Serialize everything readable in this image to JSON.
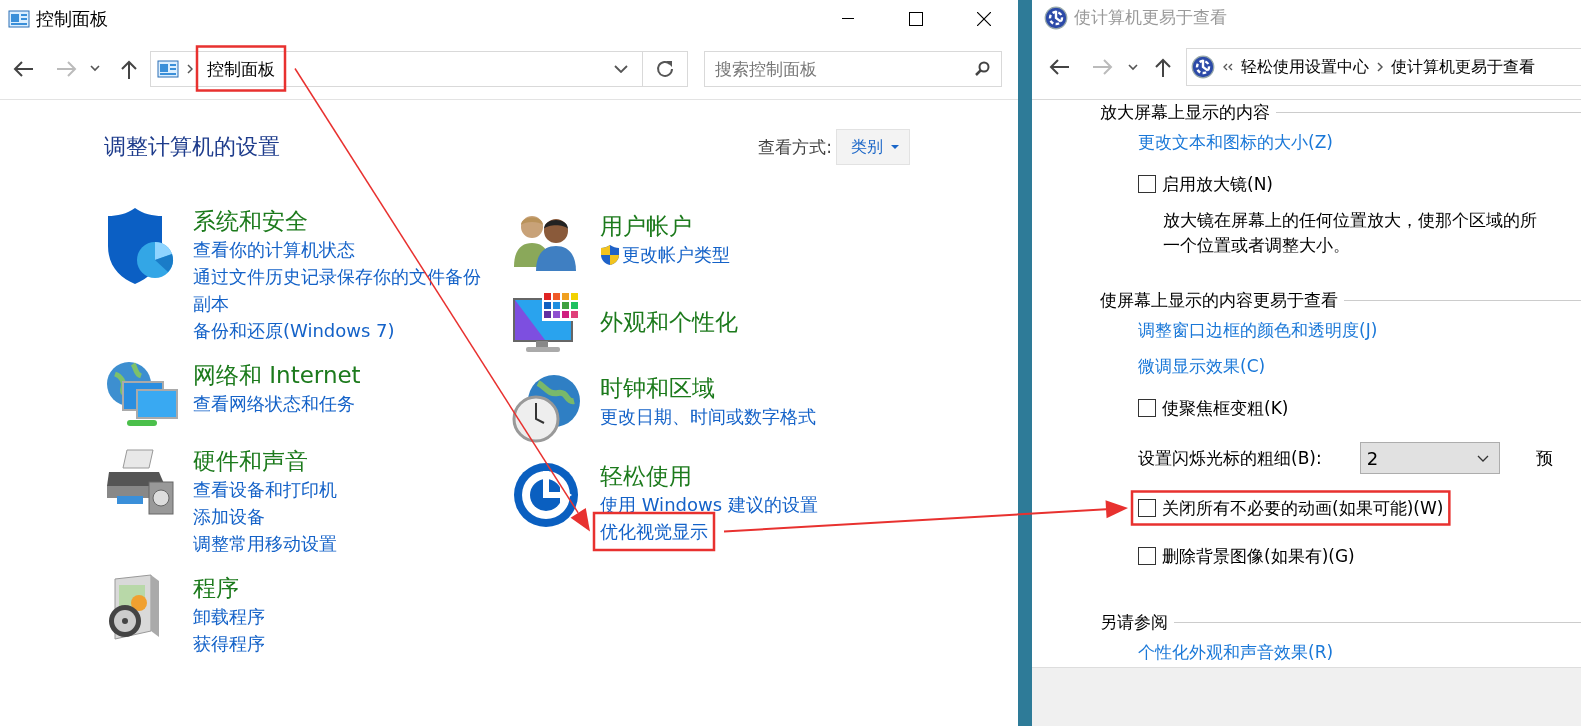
{
  "control_panel": {
    "title": "控制面板",
    "address": {
      "text": "控制面板",
      "highlighted": true
    },
    "search": {
      "placeholder": "搜索控制面板"
    },
    "heading": "调整计算机的设置",
    "view_by": {
      "label": "查看方式:",
      "value": "类别"
    },
    "columns": [
      [
        {
          "kind": "security",
          "title": "系统和安全",
          "links": [
            {
              "kind": "link",
              "text": "查看你的计算机状态",
              "highlighted": false
            },
            {
              "kind": "link",
              "text": "通过文件历史记录保存你的文件备份副本",
              "highlighted": false
            },
            {
              "kind": "link",
              "text": "备份和还原(Windows 7)",
              "highlighted": false
            }
          ]
        },
        {
          "kind": "network",
          "title": "网络和 Internet",
          "links": [
            {
              "kind": "link",
              "text": "查看网络状态和任务",
              "highlighted": false
            }
          ]
        },
        {
          "kind": "hardware",
          "title": "硬件和声音",
          "links": [
            {
              "kind": "link",
              "text": "查看设备和打印机",
              "highlighted": false
            },
            {
              "kind": "link",
              "text": "添加设备",
              "highlighted": false
            },
            {
              "kind": "link",
              "text": "调整常用移动设置",
              "highlighted": false
            }
          ]
        },
        {
          "kind": "programs",
          "title": "程序",
          "links": [
            {
              "kind": "link",
              "text": "卸载程序",
              "highlighted": false
            },
            {
              "kind": "link",
              "text": "获得程序",
              "highlighted": false
            }
          ]
        }
      ],
      [
        {
          "kind": "users",
          "title": "用户帐户",
          "links": [
            {
              "kind": "shield-link",
              "text": "更改帐户类型"
            }
          ]
        },
        {
          "kind": "appearance",
          "title": "外观和个性化"
        },
        {
          "kind": "clock",
          "title": "时钟和区域",
          "links": [
            {
              "kind": "link",
              "text": "更改日期、时间或数字格式",
              "highlighted": false
            }
          ]
        },
        {
          "kind": "ease",
          "title": "轻松使用",
          "links": [
            {
              "kind": "link",
              "text": "使用 Windows 建议的设置",
              "highlighted": false
            },
            {
              "kind": "link",
              "text": "优化视觉显示",
              "highlighted": true
            }
          ]
        }
      ]
    ]
  },
  "ease_of_access": {
    "title": "使计算机更易于查看",
    "breadcrumb": [
      "轻松使用设置中心",
      "使计算机更易于查看"
    ],
    "sections": [
      {
        "heading": "放大屏幕上显示的内容",
        "items": [
          {
            "kind": "link",
            "text": "更改文本和图标的大小(Z)"
          },
          {
            "kind": "checkbox",
            "label": "启用放大镜(N)",
            "checked": false
          },
          {
            "kind": "description",
            "text": "放大镜在屏幕上的任何位置放大，使那个区域的所"
          },
          {
            "kind": "description",
            "text": "一个位置或者调整大小。"
          }
        ]
      },
      {
        "heading": "使屏幕上显示的内容更易于查看",
        "items": [
          {
            "kind": "link",
            "text": "调整窗口边框的颜色和透明度(J)"
          },
          {
            "kind": "link",
            "text": "微调显示效果(C)"
          },
          {
            "kind": "checkbox",
            "label": "使聚焦框变粗(K)",
            "checked": false
          },
          {
            "kind": "select",
            "label": "设置闪烁光标的粗细(B):",
            "value": "2",
            "preview": "预"
          },
          {
            "kind": "checkbox",
            "label": "关闭所有不必要的动画(如果可能)(W)",
            "checked": false,
            "highlighted": true
          },
          {
            "kind": "checkbox",
            "label": "删除背景图像(如果有)(G)",
            "checked": false
          }
        ]
      },
      {
        "heading": "另请参阅",
        "items": [
          {
            "kind": "link",
            "text": "个性化外观和声音效果(R)"
          }
        ]
      }
    ]
  }
}
